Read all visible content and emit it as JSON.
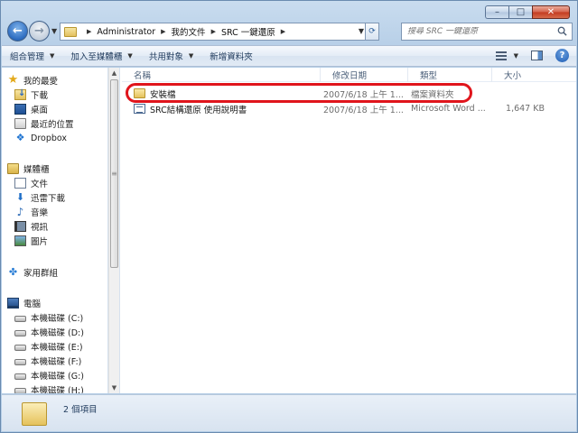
{
  "window": {
    "minimize": "–",
    "maximize": "□",
    "close": "✕"
  },
  "address": {
    "crumbs": [
      "Administrator",
      "我的文件",
      "SRC 一鍵還原"
    ]
  },
  "search": {
    "placeholder": "搜尋 SRC 一鍵還原"
  },
  "toolbar": {
    "organize": "組合管理",
    "add_to_library": "加入至媒體櫃",
    "share_with": "共用對象",
    "new_folder": "新增資料夾"
  },
  "sidebar": {
    "favorites": {
      "label": "我的最愛",
      "items": [
        "下載",
        "桌面",
        "最近的位置",
        "Dropbox"
      ]
    },
    "libraries": {
      "label": "媒體櫃",
      "items": [
        "文件",
        "迅雷下載",
        "音樂",
        "視訊",
        "圖片"
      ]
    },
    "homegroup": {
      "label": "家用群組"
    },
    "computer": {
      "label": "電腦",
      "items": [
        "本機磁碟 (C:)",
        "本機磁碟 (D:)",
        "本機磁碟 (E:)",
        "本機磁碟 (F:)",
        "本機磁碟 (G:)",
        "本機磁碟 (H:)"
      ]
    }
  },
  "files": {
    "columns": {
      "name": "名稱",
      "date": "修改日期",
      "type": "類型",
      "size": "大小"
    },
    "rows": [
      {
        "name": "安裝檔",
        "date": "2007/6/18 上午 1...",
        "type": "檔案資料夾",
        "size": "",
        "icon": "folder-icon"
      },
      {
        "name": "SRC結構還原 使用說明書",
        "date": "2007/6/18 上午 1...",
        "type": "Microsoft Word ...",
        "size": "1,647 KB",
        "icon": "word-document-icon"
      }
    ]
  },
  "status": {
    "item_count": "2 個項目"
  },
  "colors": {
    "highlight": "#e0151c",
    "accent": "#2d6cc0"
  }
}
